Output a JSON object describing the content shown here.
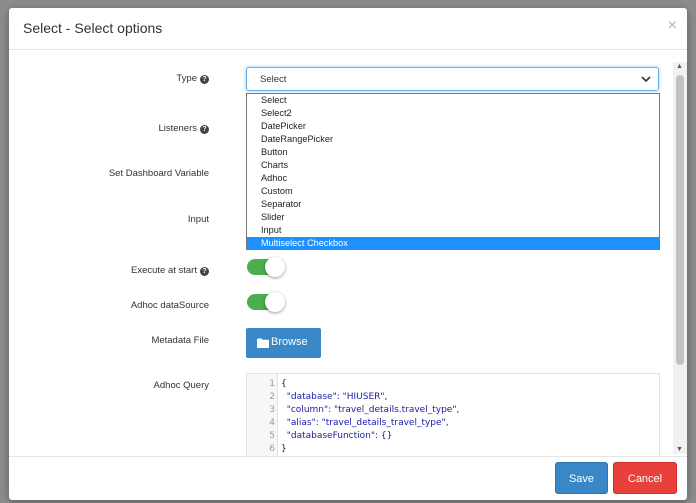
{
  "modal": {
    "title": "Select - Select options",
    "close_label": "×"
  },
  "form": {
    "type_label": "Type",
    "listeners_label": "Listeners",
    "dashboard_variable_label": "Set Dashboard Variable",
    "input_label": "Input",
    "execute_at_start_label": "Execute at start",
    "adhoc_datasource_label": "Adhoc dataSource",
    "metadata_file_label": "Metadata File",
    "adhoc_query_label": "Adhoc Query",
    "help_icon": "?"
  },
  "type_select": {
    "value": "Select",
    "options": [
      "Select",
      "Select2",
      "DatePicker",
      "DateRangePicker",
      "Button",
      "Charts",
      "Adhoc",
      "Custom",
      "Separator",
      "Slider",
      "Input",
      "Multiselect Checkbox"
    ],
    "highlighted": "Multiselect Checkbox"
  },
  "toggles": {
    "execute_at_start": true,
    "adhoc_datasource": true
  },
  "browse_button": {
    "label": "Browse",
    "icon": "folder-icon"
  },
  "editor": {
    "line_numbers": [
      "1",
      "2",
      "3",
      "4",
      "5",
      "6"
    ],
    "lines": [
      "{",
      "  \"database\": \"HIUSER\",",
      "  \"column\": \"travel_details.travel_type\",",
      "  \"alias\": \"travel_details_travel_type\",",
      "  \"databaseFunction\": {}",
      "}"
    ]
  },
  "footer": {
    "save_label": "Save",
    "cancel_label": "Cancel"
  },
  "colors": {
    "primary": "#3a87c8",
    "danger": "#e8403a",
    "toggle_on": "#4cae4c",
    "dropdown_highlight": "#1e90ff"
  }
}
